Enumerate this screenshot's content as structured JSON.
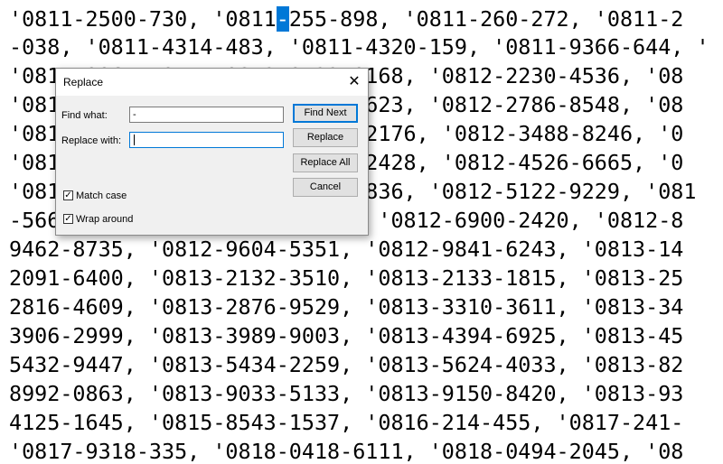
{
  "editor": {
    "lines": [
      {
        "text": "'0811-2500-730, '0811",
        "highlight": "-",
        "after": "255-898, '0811-260-272, '0811-2"
      },
      {
        "text": "-038, '0811-4314-483, '0811-4320-159, '0811-9366-644, '"
      },
      {
        "text": "'0811-9967-705, '0812-0122-0168, '0812-2230-4536, '08"
      },
      {
        "text": "'0812-2623-4372, '0812-2708-623, '0812-2786-8548, '08"
      },
      {
        "text": "'0812-2955-7715, '0812-2977-2176, '0812-3488-8246, '0"
      },
      {
        "text": "'0812-3713-6613, '0812-4140-2428, '0812-4526-6665, '0"
      },
      {
        "text": "'0812-4729-5599, '0812-4901-836, '0812-5122-9229, '081"
      },
      {
        "text": "-5661-4456, '0812-6263-2251, '0812-6900-2420, '0812-8"
      },
      {
        "text": "9462-8735, '0812-9604-5351, '0812-9841-6243, '0813-14"
      },
      {
        "text": "2091-6400, '0813-2132-3510, '0813-2133-1815, '0813-25"
      },
      {
        "text": "2816-4609, '0813-2876-9529, '0813-3310-3611, '0813-34"
      },
      {
        "text": "3906-2999, '0813-3989-9003, '0813-4394-6925, '0813-45"
      },
      {
        "text": "5432-9447, '0813-5434-2259, '0813-5624-4033, '0813-82"
      },
      {
        "text": "8992-0863, '0813-9033-5133, '0813-9150-8420, '0813-93"
      },
      {
        "text": "4125-1645, '0815-8543-1537, '0816-214-455, '0817-241-"
      },
      {
        "text": "'0817-9318-335, '0818-0418-6111, '0818-0494-2045, '08"
      }
    ]
  },
  "dialog": {
    "title": "Replace",
    "close_glyph": "✕",
    "find_label": "Find what:",
    "find_value": "-",
    "replace_label": "Replace with:",
    "replace_value": "",
    "find_next": "Find Next",
    "replace": "Replace",
    "replace_all": "Replace All",
    "cancel": "Cancel",
    "match_case": {
      "label": "Match case",
      "checked": true
    },
    "wrap_around": {
      "label": "Wrap around",
      "checked": true
    },
    "check_glyph": "✓"
  }
}
